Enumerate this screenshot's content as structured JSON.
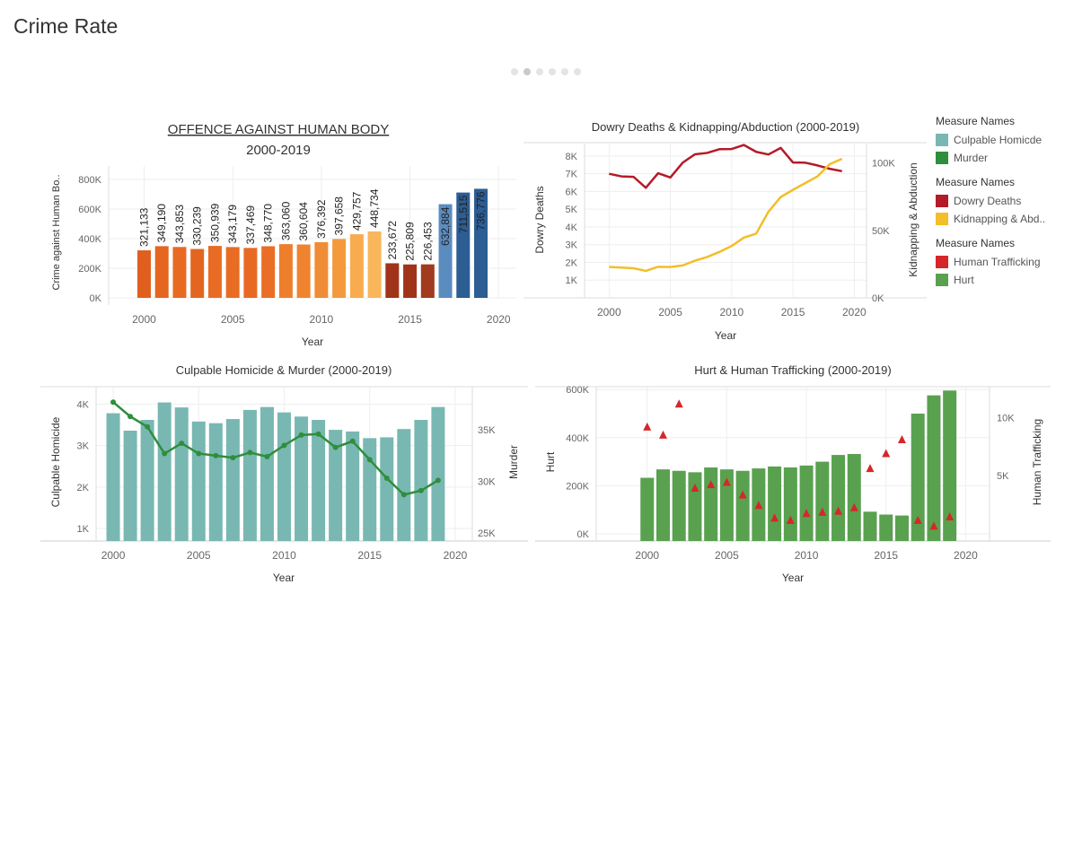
{
  "page": {
    "title": "Crime Rate",
    "pager_dots": 6,
    "pager_active": 1
  },
  "colors": {
    "culpable": "#79b8b2",
    "murder": "#2f8e3c",
    "dowry": "#b51a28",
    "kidnap": "#f2be2a",
    "trafficking": "#d62728",
    "hurt": "#59a14f",
    "axis_text": "#666666",
    "grid": "#eeeeee"
  },
  "legend": {
    "groups": [
      {
        "title": "Measure Names",
        "items": [
          {
            "label": "Culpable Homicde",
            "color": "#79b8b2"
          },
          {
            "label": "Murder",
            "color": "#2f8e3c"
          }
        ]
      },
      {
        "title": "Measure Names",
        "items": [
          {
            "label": "Dowry Deaths",
            "color": "#b51a28"
          },
          {
            "label": "Kidnapping & Abd..",
            "color": "#f2be2a"
          }
        ]
      },
      {
        "title": "Measure Names",
        "items": [
          {
            "label": "Human Trafficking",
            "color": "#d62728"
          },
          {
            "label": "Hurt",
            "color": "#59a14f"
          }
        ]
      }
    ]
  },
  "chart_data": [
    {
      "id": "offence",
      "type": "bar",
      "title": "OFFENCE AGAINST HUMAN BODY",
      "subtitle": "2000-2019",
      "xlabel": "Year",
      "ylabel": "Crime against Human Bo..",
      "x": [
        2000,
        2001,
        2002,
        2003,
        2004,
        2005,
        2006,
        2007,
        2008,
        2009,
        2010,
        2011,
        2012,
        2013,
        2014,
        2015,
        2016,
        2017,
        2018,
        2019
      ],
      "values": [
        321133,
        349190,
        343853,
        330239,
        350939,
        343179,
        337469,
        348770,
        363060,
        360604,
        376392,
        397658,
        429757,
        448734,
        233672,
        225809,
        226453,
        632884,
        711515,
        736776
      ],
      "labels": [
        "321,133",
        "349,190",
        "343,853",
        "330,239",
        "350,939",
        "343,179",
        "337,469",
        "348,770",
        "363,060",
        "360,604",
        "376,392",
        "397,658",
        "429,757",
        "448,734",
        "233,672",
        "225,809",
        "226,453",
        "632,884",
        "711,515",
        "736,776"
      ],
      "colors": [
        "#e05f1f",
        "#e5661f",
        "#e86a22",
        "#e36620",
        "#e96c24",
        "#e96c24",
        "#e86a22",
        "#ea6e25",
        "#ef7e2c",
        "#f08330",
        "#f08c35",
        "#f49a3d",
        "#f8ac4f",
        "#fab65a",
        "#a0331a",
        "#a0331a",
        "#a13a1f",
        "#5b8cc0",
        "#2c5d93",
        "#2c5d93"
      ],
      "yticks": [
        0,
        200000,
        400000,
        600000,
        800000
      ],
      "ytick_labels": [
        "0K",
        "200K",
        "400K",
        "600K",
        "800K"
      ],
      "ylim": [
        0,
        800000
      ],
      "xticks": [
        2000,
        2005,
        2010,
        2015,
        2020
      ],
      "xlim": [
        1998,
        2021
      ],
      "grid": true
    },
    {
      "id": "dowry",
      "type": "line",
      "title": "Dowry Deaths & Kidnapping/Abduction (2000-2019)",
      "xlabel": "Year",
      "ylabel_left": "Dowry Deaths",
      "ylabel_right": "Kidnapping & Abduction",
      "x": [
        2000,
        2001,
        2002,
        2003,
        2004,
        2005,
        2006,
        2007,
        2008,
        2009,
        2010,
        2011,
        2012,
        2013,
        2014,
        2015,
        2016,
        2017,
        2018,
        2019
      ],
      "series": [
        {
          "name": "Dowry Deaths",
          "axis": "left",
          "color": "#b51a28",
          "values": [
            6995,
            6850,
            6822,
            6208,
            7026,
            6787,
            7618,
            8093,
            8172,
            8383,
            8391,
            8618,
            8233,
            8083,
            8455,
            7634,
            7621,
            7466,
            7277,
            7141
          ]
        },
        {
          "name": "Kidnapping & Abd..",
          "axis": "right",
          "color": "#f2be2a",
          "values": [
            22938,
            22435,
            21946,
            19991,
            23020,
            22832,
            23991,
            27561,
            30297,
            34015,
            38440,
            44664,
            47592,
            63780,
            74690,
            80000,
            85000,
            90000,
            99000,
            103000
          ]
        }
      ],
      "left_ticks": [
        1000,
        2000,
        3000,
        4000,
        5000,
        6000,
        7000,
        8000
      ],
      "left_tick_labels": [
        "1K",
        "2K",
        "3K",
        "4K",
        "5K",
        "6K",
        "7K",
        "8K"
      ],
      "left_lim": [
        0,
        8700
      ],
      "right_ticks": [
        0,
        50000,
        100000
      ],
      "right_tick_labels": [
        "0K",
        "50K",
        "100K"
      ],
      "right_lim": [
        0,
        105000
      ],
      "xticks": [
        2000,
        2005,
        2010,
        2015,
        2020
      ],
      "xlim": [
        1998,
        2021
      ],
      "grid": true
    },
    {
      "id": "culpable",
      "type": "bar",
      "title": "Culpable Homicide & Murder (2000-2019)",
      "xlabel": "Year",
      "ylabel_left": "Culpable Homicide",
      "ylabel_right": "Murder",
      "x": [
        2000,
        2001,
        2002,
        2003,
        2004,
        2005,
        2006,
        2007,
        2008,
        2009,
        2010,
        2011,
        2012,
        2013,
        2014,
        2015,
        2016,
        2017,
        2018,
        2019
      ],
      "series": [
        {
          "name": "Culpable Homicde",
          "kind": "bar",
          "axis": "left",
          "color": "#79b8b2",
          "values": [
            3780,
            3360,
            3620,
            4040,
            3920,
            3580,
            3540,
            3640,
            3860,
            3930,
            3800,
            3700,
            3620,
            3380,
            3340,
            3180,
            3200,
            3400,
            3620,
            3930
          ]
        },
        {
          "name": "Murder",
          "kind": "line",
          "axis": "right",
          "color": "#2f8e3c",
          "values": [
            37700,
            36300,
            35300,
            32700,
            33700,
            32700,
            32500,
            32300,
            32800,
            32400,
            33500,
            34500,
            34600,
            33300,
            33900,
            32100,
            30300,
            28700,
            29100,
            30100
          ]
        }
      ],
      "left_ticks": [
        1000,
        2000,
        3000,
        4000
      ],
      "left_tick_labels": [
        "1K",
        "2K",
        "3K",
        "4K"
      ],
      "left_lim": [
        700,
        4420
      ],
      "right_ticks": [
        25000,
        30000,
        35000
      ],
      "right_tick_labels": [
        "25K",
        "30K",
        "35K"
      ],
      "right_lim": [
        24200,
        39200
      ],
      "xticks": [
        2000,
        2005,
        2010,
        2015,
        2020
      ],
      "xlim": [
        1999,
        2021
      ],
      "grid": true
    },
    {
      "id": "hurt",
      "type": "bar",
      "title": "Hurt & Human Trafficking (2000-2019)",
      "xlabel": "Year",
      "ylabel_left": "Hurt",
      "ylabel_right": "Human Trafficking",
      "x": [
        2000,
        2001,
        2002,
        2003,
        2004,
        2005,
        2006,
        2007,
        2008,
        2009,
        2010,
        2011,
        2012,
        2013,
        2014,
        2015,
        2016,
        2017,
        2018,
        2019
      ],
      "series": [
        {
          "name": "Hurt",
          "kind": "bar",
          "axis": "left",
          "color": "#59a14f",
          "values": [
            233000,
            268000,
            262000,
            256000,
            276000,
            268000,
            262000,
            272000,
            280000,
            276000,
            284000,
            300000,
            328000,
            332000,
            92000,
            80000,
            76000,
            500000,
            576000,
            596000
          ]
        },
        {
          "name": "Human Trafficking",
          "kind": "triangle",
          "axis": "right",
          "color": "#d62728",
          "values": [
            9200,
            8500,
            11200,
            3900,
            4200,
            4400,
            3300,
            2400,
            1300,
            1100,
            1700,
            1800,
            1900,
            2200,
            5600,
            6900,
            8100,
            1100,
            600,
            1400
          ]
        }
      ],
      "left_ticks": [
        0,
        200000,
        400000,
        600000
      ],
      "left_tick_labels": [
        "0K",
        "200K",
        "400K",
        "600K"
      ],
      "left_lim": [
        -30000,
        612000
      ],
      "right_ticks": [
        5000,
        10000
      ],
      "right_tick_labels": [
        "5K",
        "10K"
      ],
      "right_lim": [
        -700,
        12700
      ],
      "xticks": [
        2000,
        2005,
        2010,
        2015,
        2020
      ],
      "xlim": [
        1996.8,
        2021.5
      ],
      "grid": true
    }
  ]
}
